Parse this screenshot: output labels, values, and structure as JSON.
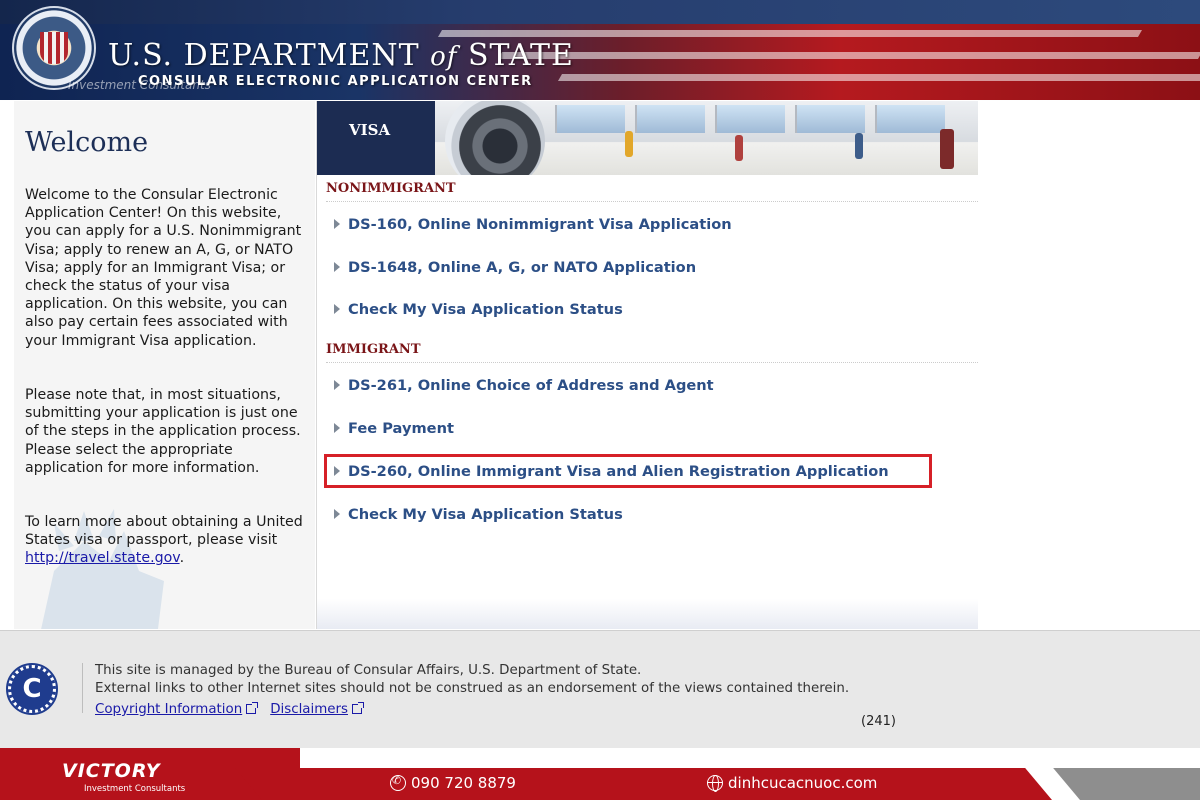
{
  "header": {
    "title_prefix": "U.S. DEPARTMENT",
    "title_of": "of",
    "title_suffix": "STATE",
    "subtitle": "CONSULAR ELECTRONIC APPLICATION CENTER",
    "watermark": "Investment Consultants"
  },
  "sidebar": {
    "title": "Welcome",
    "paragraph1": "Welcome to the Consular Electronic Application Center! On this website, you can apply for a U.S. Nonimmigrant Visa; apply to renew an A, G, or NATO Visa; apply for an Immigrant Visa; or check the status of your visa application. On this website, you can also pay certain fees associated with your Immigrant Visa application.",
    "paragraph2": "Please note that, in most situations, submitting your application is just one of the steps in the application process. Please select the appropriate application for more information.",
    "paragraph3_prefix": "To learn more about obtaining a United States visa or passport, please visit ",
    "paragraph3_link": "http://travel.state.gov",
    "paragraph3_suffix": "."
  },
  "main": {
    "banner_label": "VISA",
    "nonimmigrant": {
      "heading": "NONIMMIGRANT",
      "links": [
        {
          "label": "DS-160, Online Nonimmigrant Visa Application"
        },
        {
          "label": "DS-1648, Online A, G, or NATO Application"
        },
        {
          "label": "Check My Visa Application Status"
        }
      ]
    },
    "immigrant": {
      "heading": "IMMIGRANT",
      "links": [
        {
          "label": "DS-261, Online Choice of Address and Agent"
        },
        {
          "label": "Fee Payment"
        },
        {
          "label": "DS-260, Online Immigrant Visa and Alien Registration Application"
        },
        {
          "label": "Check My Visa Application Status"
        }
      ]
    }
  },
  "footer": {
    "logo_letter": "C",
    "line1": "This site is managed by the Bureau of Consular Affairs, U.S. Department of State.",
    "line2": "External links to other Internet sites should not be construed as an endorsement of the views contained therein.",
    "copyright_link": "Copyright Information",
    "disclaimers_link": "Disclaimers",
    "counter": "(241)"
  },
  "promo": {
    "brand": "VICTORY",
    "brand_sub": "Investment Consultants",
    "phone": "090 720 8879",
    "website": "dinhcucacnuoc.com"
  },
  "colors": {
    "navy": "#1c2c52",
    "section_heading": "#7a1518",
    "link": "#2c4f86",
    "highlight": "#d62027",
    "promo_red": "#b5121b"
  }
}
